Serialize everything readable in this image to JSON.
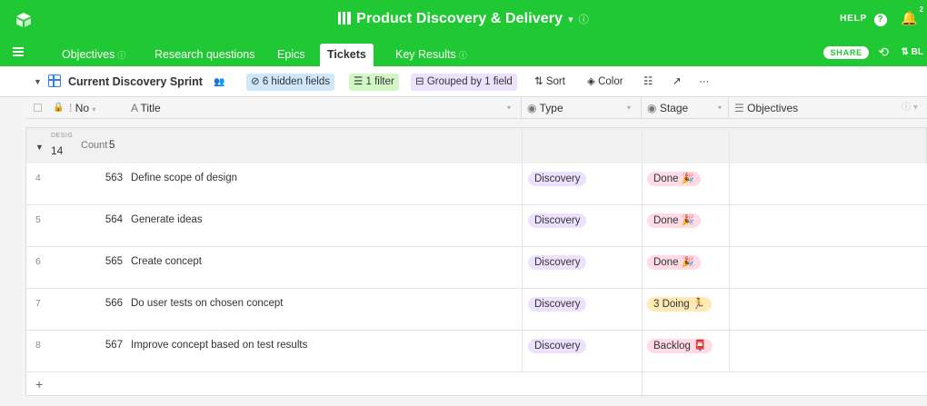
{
  "header": {
    "title": "Product Discovery & Delivery",
    "help_label": "HELP",
    "notif_count": "2"
  },
  "tabs": [
    {
      "label": "Objectives",
      "has_info": true
    },
    {
      "label": "Research questions",
      "has_info": false
    },
    {
      "label": "Epics",
      "has_info": false
    },
    {
      "label": "Tickets",
      "has_info": false,
      "active": true
    },
    {
      "label": "Key Results",
      "has_info": true
    }
  ],
  "tabsbar_right": {
    "share_label": "SHARE",
    "bases_label": "BL"
  },
  "toolbar": {
    "view_name": "Current Discovery Sprint",
    "hidden_fields": "6 hidden fields",
    "filter": "1 filter",
    "grouped": "Grouped by 1 field",
    "sort": "Sort",
    "color": "Color",
    "more": "···"
  },
  "columns": {
    "no": "No",
    "title": "Title",
    "type": "Type",
    "stage": "Stage",
    "objectives": "Objectives"
  },
  "group": {
    "label": "DESIG",
    "value": "14",
    "count_label": "Count",
    "count": "5"
  },
  "rows": [
    {
      "row_num": "4",
      "no": "563",
      "title": "Define scope of design",
      "type": "Discovery",
      "stage": "Done 🎉",
      "stage_kind": "done"
    },
    {
      "row_num": "5",
      "no": "564",
      "title": "Generate ideas",
      "type": "Discovery",
      "stage": "Done 🎉",
      "stage_kind": "done"
    },
    {
      "row_num": "6",
      "no": "565",
      "title": "Create concept",
      "type": "Discovery",
      "stage": "Done 🎉",
      "stage_kind": "done"
    },
    {
      "row_num": "7",
      "no": "566",
      "title": "Do user tests on chosen concept",
      "type": "Discovery",
      "stage": "3 Doing 🏃",
      "stage_kind": "doing"
    },
    {
      "row_num": "8",
      "no": "567",
      "title": "Improve concept based on test results",
      "type": "Discovery",
      "stage": "Backlog 📮",
      "stage_kind": "backlog"
    }
  ],
  "add_row": "+",
  "colors": {
    "brand": "#20c933",
    "type_pill": "#ede2fe",
    "done": "#ffdce5",
    "doing": "#ffeab6"
  }
}
